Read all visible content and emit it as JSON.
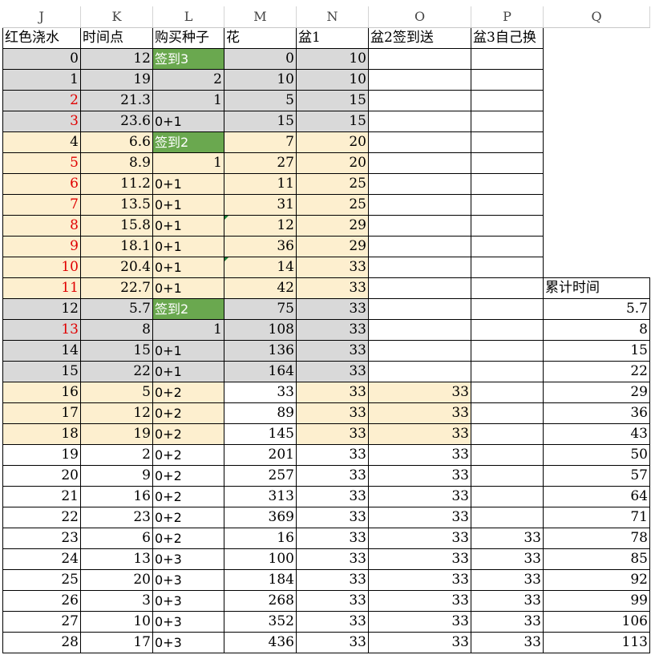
{
  "columns": [
    "J",
    "K",
    "L",
    "M",
    "N",
    "O",
    "P",
    "Q"
  ],
  "headers": [
    "红色浇水",
    "时间点",
    "购买种子",
    "花",
    "盆1",
    "盆2签到送",
    "盆3自己换",
    ""
  ],
  "q_header": "累计时间",
  "rows": [
    {
      "j": "0",
      "k": "12",
      "l": "签到3",
      "m": "0",
      "n": "10",
      "o": "",
      "p": "",
      "q": ""
    },
    {
      "j": "1",
      "k": "19",
      "l": "2",
      "m": "10",
      "n": "10",
      "o": "",
      "p": "",
      "q": ""
    },
    {
      "j": "2",
      "k": "21.3",
      "l": "1",
      "m": "5",
      "n": "15",
      "o": "",
      "p": "",
      "q": ""
    },
    {
      "j": "3",
      "k": "23.6",
      "l": "0+1",
      "m": "15",
      "n": "15",
      "o": "",
      "p": "",
      "q": ""
    },
    {
      "j": "4",
      "k": "6.6",
      "l": "签到2",
      "m": "7",
      "n": "20",
      "o": "",
      "p": "",
      "q": ""
    },
    {
      "j": "5",
      "k": "8.9",
      "l": "1",
      "m": "27",
      "n": "20",
      "o": "",
      "p": "",
      "q": ""
    },
    {
      "j": "6",
      "k": "11.2",
      "l": "0+1",
      "m": "11",
      "n": "25",
      "o": "",
      "p": "",
      "q": ""
    },
    {
      "j": "7",
      "k": "13.5",
      "l": "0+1",
      "m": "31",
      "n": "25",
      "o": "",
      "p": "",
      "q": ""
    },
    {
      "j": "8",
      "k": "15.8",
      "l": "0+1",
      "m": "12",
      "n": "29",
      "o": "",
      "p": "",
      "q": ""
    },
    {
      "j": "9",
      "k": "18.1",
      "l": "0+1",
      "m": "36",
      "n": "29",
      "o": "",
      "p": "",
      "q": ""
    },
    {
      "j": "10",
      "k": "20.4",
      "l": "0+1",
      "m": "14",
      "n": "33",
      "o": "",
      "p": "",
      "q": ""
    },
    {
      "j": "11",
      "k": "22.7",
      "l": "0+1",
      "m": "42",
      "n": "33",
      "o": "",
      "p": "",
      "q": ""
    },
    {
      "j": "12",
      "k": "5.7",
      "l": "签到2",
      "m": "75",
      "n": "33",
      "o": "",
      "p": "",
      "q": "5.7"
    },
    {
      "j": "13",
      "k": "8",
      "l": "1",
      "m": "108",
      "n": "33",
      "o": "",
      "p": "",
      "q": "8"
    },
    {
      "j": "14",
      "k": "15",
      "l": "0+1",
      "m": "136",
      "n": "33",
      "o": "",
      "p": "",
      "q": "15"
    },
    {
      "j": "15",
      "k": "22",
      "l": "0+1",
      "m": "164",
      "n": "33",
      "o": "",
      "p": "",
      "q": "22"
    },
    {
      "j": "16",
      "k": "5",
      "l": "0+2",
      "m": "33",
      "n": "33",
      "o": "33",
      "p": "",
      "q": "29"
    },
    {
      "j": "17",
      "k": "12",
      "l": "0+2",
      "m": "89",
      "n": "33",
      "o": "33",
      "p": "",
      "q": "36"
    },
    {
      "j": "18",
      "k": "19",
      "l": "0+2",
      "m": "145",
      "n": "33",
      "o": "33",
      "p": "",
      "q": "43"
    },
    {
      "j": "19",
      "k": "2",
      "l": "0+2",
      "m": "201",
      "n": "33",
      "o": "33",
      "p": "",
      "q": "50"
    },
    {
      "j": "20",
      "k": "9",
      "l": "0+2",
      "m": "257",
      "n": "33",
      "o": "33",
      "p": "",
      "q": "57"
    },
    {
      "j": "21",
      "k": "16",
      "l": "0+2",
      "m": "313",
      "n": "33",
      "o": "33",
      "p": "",
      "q": "64"
    },
    {
      "j": "22",
      "k": "23",
      "l": "0+2",
      "m": "369",
      "n": "33",
      "o": "33",
      "p": "",
      "q": "71"
    },
    {
      "j": "23",
      "k": "6",
      "l": "0+2",
      "m": "16",
      "n": "33",
      "o": "33",
      "p": "33",
      "q": "78"
    },
    {
      "j": "24",
      "k": "13",
      "l": "0+3",
      "m": "100",
      "n": "33",
      "o": "33",
      "p": "33",
      "q": "85"
    },
    {
      "j": "25",
      "k": "20",
      "l": "0+3",
      "m": "184",
      "n": "33",
      "o": "33",
      "p": "33",
      "q": "92"
    },
    {
      "j": "26",
      "k": "3",
      "l": "0+3",
      "m": "268",
      "n": "33",
      "o": "33",
      "p": "33",
      "q": "99"
    },
    {
      "j": "27",
      "k": "10",
      "l": "0+3",
      "m": "352",
      "n": "33",
      "o": "33",
      "p": "33",
      "q": "106"
    },
    {
      "j": "28",
      "k": "17",
      "l": "0+3",
      "m": "436",
      "n": "33",
      "o": "33",
      "p": "33",
      "q": "113"
    }
  ],
  "colors": {
    "gray": "#d9d9d9",
    "tan": "#fdefcf",
    "green": "#6aa84f",
    "red": "#e00000"
  }
}
